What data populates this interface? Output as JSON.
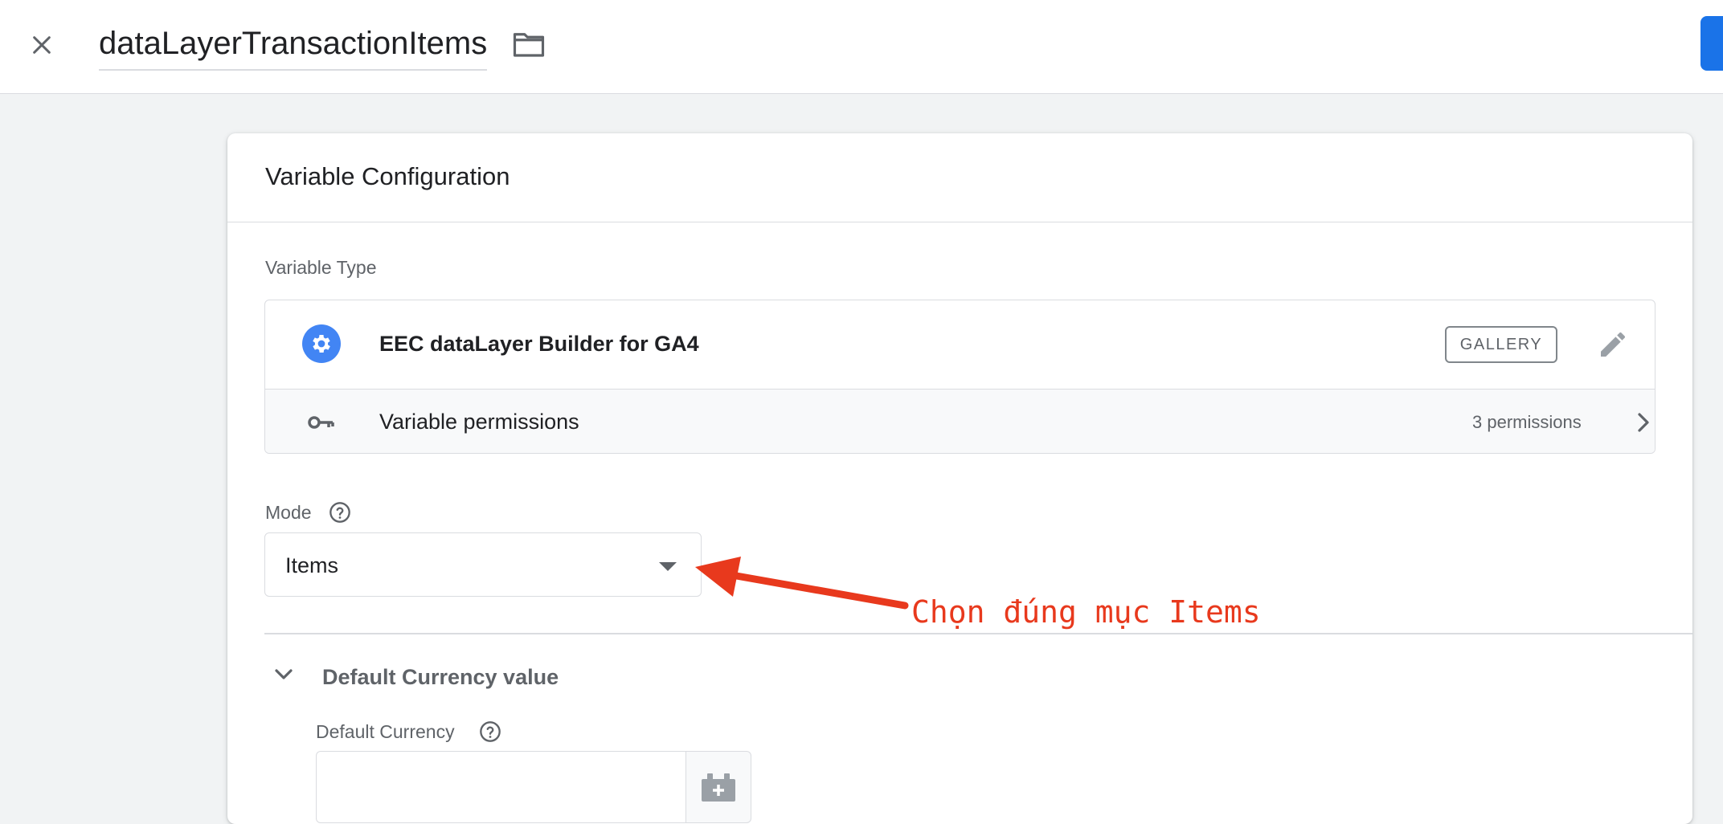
{
  "header": {
    "title": "dataLayerTransactionItems",
    "close_icon": "close-icon",
    "folder_icon": "folder-icon",
    "save_button_color": "#1a73e8"
  },
  "card": {
    "title": "Variable Configuration",
    "variable_type": {
      "label": "Variable Type",
      "name": "EEC dataLayer Builder for GA4",
      "badge": "GALLERY",
      "type_icon": "gear-icon",
      "edit_icon": "pencil-icon",
      "permissions": {
        "label": "Variable permissions",
        "count": "3 permissions",
        "icon": "key-icon",
        "chevron_icon": "chevron-right-icon"
      }
    },
    "mode": {
      "label": "Mode",
      "help_icon": "help-circle-icon",
      "selected": "Items"
    },
    "default_currency_section": {
      "title": "Default Currency value",
      "collapse_icon": "chevron-down-icon",
      "field_label": "Default Currency",
      "field_value": "",
      "variable_picker_icon": "variable-picker-icon"
    }
  },
  "annotation": {
    "text": "Chọn đúng mục Items",
    "color": "#e8391d"
  }
}
